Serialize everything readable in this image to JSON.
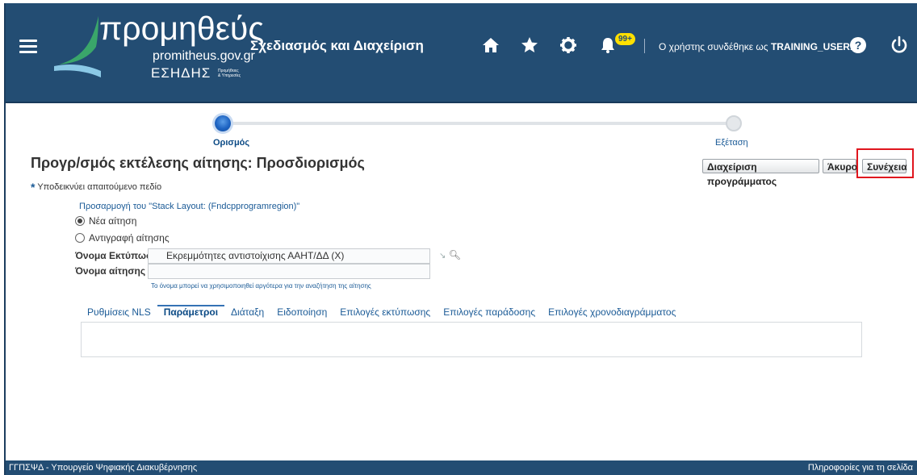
{
  "header": {
    "logo_title": "προμηθεύς",
    "logo_url": "promitheus.gov.gr",
    "logo_org": "ΕΣΗΔΗΣ",
    "logo_org_sub": "Προμήθειες & Υπηρεσίες",
    "app_title": "Σχεδιασμός και Διαχείριση",
    "notification_badge": "99+",
    "user_prefix": "Ο χρήστης συνδέθηκε ως",
    "user_name": "TRAINING_USER1"
  },
  "train": {
    "step1": "Ορισμός",
    "step2": "Εξέταση"
  },
  "page": {
    "title": "Προγρ/σμός εκτέλεσης αίτησης: Προσδιορισμός",
    "required_note": "Υποδεικνύει απαιτούμενο πεδίο",
    "required_star": "*"
  },
  "buttons": {
    "manage_schedule": "Διαχείριση προγράμματος",
    "cancel": "Άκυρο",
    "continue": "Συνέχεια"
  },
  "form": {
    "customize_link": "Προσαρμογή του \"Stack Layout: (Fndcpprogramregion)\"",
    "radio_new": "Νέα αίτηση",
    "radio_copy": "Αντιγραφή αίτησης",
    "radio_selected": "new",
    "print_name_label": "Όνομα Εκτύπωσης",
    "print_name_value": "Εκρεμμότητες αντιστοίχισης ΑΑΗΤ/ΔΔ (Χ)",
    "request_name_label": "Όνομα αίτησης",
    "request_name_value": "",
    "request_name_hint": "Το όνομα μπορεί να χρησιμοποιηθεί αργότερα για την αναζήτηση της αίτησης"
  },
  "tabs": [
    {
      "label": "Ρυθμίσεις NLS",
      "active": false
    },
    {
      "label": "Παράμετροι",
      "active": true
    },
    {
      "label": "Διάταξη",
      "active": false
    },
    {
      "label": "Ειδοποίηση",
      "active": false
    },
    {
      "label": "Επιλογές εκτύπωσης",
      "active": false
    },
    {
      "label": "Επιλογές παράδοσης",
      "active": false
    },
    {
      "label": "Επιλογές χρονοδιαγράμματος",
      "active": false
    }
  ],
  "footer": {
    "left": "ΓΓΠΣΨΔ - Υπουργείο Ψηφιακής Διακυβέρνησης",
    "right": "Πληροφορίες για τη σελίδα"
  },
  "colors": {
    "header_bg": "#234d73",
    "link": "#1a5a96",
    "highlight": "#e0161e",
    "badge": "#ffe000"
  },
  "icons": [
    "hamburger-menu-icon",
    "home-icon",
    "star-icon",
    "gear-icon",
    "bell-icon",
    "help-icon",
    "power-icon",
    "search-icon",
    "clear-icon"
  ]
}
